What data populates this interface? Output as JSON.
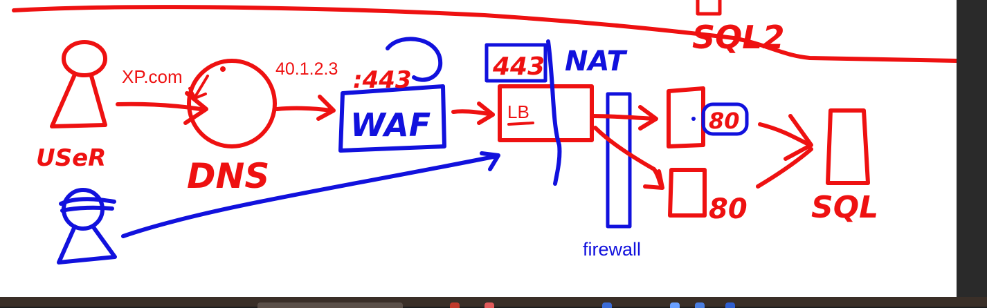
{
  "colors": {
    "red": "#ee1111",
    "blue": "#1111dd",
    "canvas": "#ffffff",
    "background": "#1e1e1e",
    "taskbar": "#3a2f28"
  },
  "labels": {
    "user": "USeR",
    "domain": "XP.com",
    "dns": "DNS",
    "ip": "40.1.2.3",
    "port_https": ":443",
    "waf": "WAF",
    "nat_port": "443",
    "nat": "NAT",
    "lb": "LB",
    "web_port_1": "80",
    "web_port_2": "80",
    "sql": "SQL",
    "sql2": "SQL2",
    "firewall": "firewall"
  }
}
